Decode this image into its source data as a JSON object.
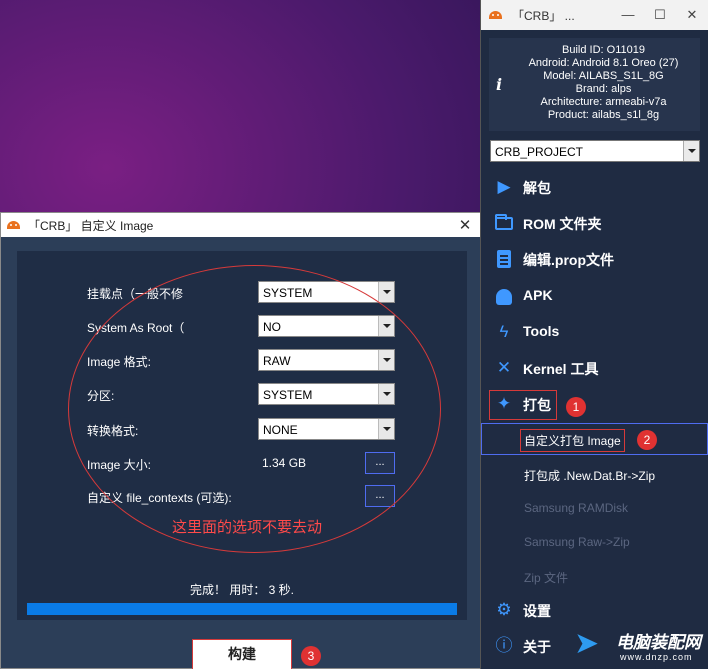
{
  "dialog": {
    "title": "「CRB」 自定义 Image",
    "close": "✕",
    "options": [
      {
        "label": "挂载点（一般不修",
        "value": "SYSTEM"
      },
      {
        "label": "System As Root（",
        "value": "NO"
      },
      {
        "label": "Image 格式:",
        "value": "RAW"
      },
      {
        "label": "分区:",
        "value": "SYSTEM"
      },
      {
        "label": "转换格式:",
        "value": "NONE"
      }
    ],
    "size_label": "Image 大小:",
    "size_value": "1.34 GB",
    "contexts_label": "自定义 file_contexts (可选):",
    "browse": "...",
    "annotation": "这里面的选项不要去动",
    "status": "完成！ 用时： 3 秒.",
    "progress": 1.0,
    "build_button": "构建",
    "badge3": "3"
  },
  "main": {
    "title": "「CRB」 ...",
    "info": {
      "build_id": "Build ID: O11019",
      "android": "Android: Android 8.1 Oreo (27)",
      "model": "Model: AILABS_S1L_8G",
      "brand": "Brand: alps",
      "arch": "Architecture: armeabi-v7a",
      "product": "Product: ailabs_s1l_8g"
    },
    "project": "CRB_PROJECT",
    "menu": {
      "unpack": "解包",
      "rom_folder": "ROM 文件夹",
      "edit_prop": "编辑.prop文件",
      "apk": "APK",
      "tools": "Tools",
      "kernel": "Kernel 工具",
      "pack": "打包",
      "settings": "设置",
      "about": "关于"
    },
    "sub": {
      "custom_image": "自定义打包 Image",
      "new_dat": "打包成 .New.Dat.Br->Zip",
      "samsung_ramdisk": "Samsung RAMDisk",
      "samsung_raw": "Samsung Raw->Zip",
      "zip": "Zip 文件"
    },
    "badge1": "1",
    "badge2": "2"
  },
  "watermark": {
    "cn": "电脑装配网",
    "en": "www.dnzp.com"
  },
  "colors": {
    "panel": "#1f2b42",
    "accent_blue": "#3f98ff",
    "annotation_red": "#d63a3a"
  }
}
